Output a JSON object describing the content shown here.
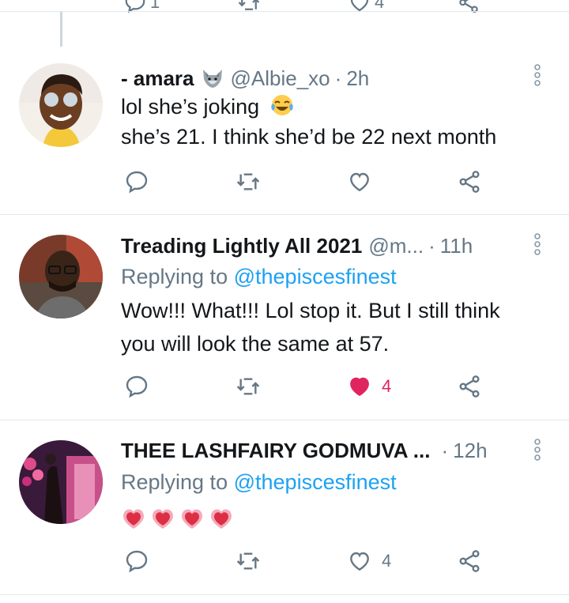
{
  "prev_tweet": {
    "reply_count": "1",
    "like_count": "4"
  },
  "tweets": [
    {
      "name": "- amara",
      "name_emoji": "wolf-emoji",
      "handle": "@Albie_xo",
      "dot": "·",
      "time": "2h",
      "lines": [
        "lol she’s joking",
        "she’s 21. I think she’d be 22 next month"
      ],
      "line_emoji": "tears-of-joy-emoji",
      "like_count": "",
      "liked": false
    },
    {
      "name": "Treading Lightly All 2021",
      "handle": "@m...",
      "dot": "·",
      "time": "11h",
      "replying_prefix": "Replying to",
      "replying_handle": "@thepiscesfinest",
      "lines": [
        "Wow!!! What!!! Lol stop it. But I still think",
        "you will look the same at 57."
      ],
      "like_count": "4",
      "liked": true
    },
    {
      "name": "THEE LASHFAIRY GODMUVA ...",
      "dot": "·",
      "time": "12h",
      "replying_prefix": "Replying to",
      "replying_handle": "@thepiscesfinest",
      "hearts": [
        "growing-heart-emoji",
        "growing-heart-emoji",
        "growing-heart-emoji",
        "growing-heart-emoji"
      ],
      "like_count": "4",
      "liked": false
    }
  ],
  "colors": {
    "link": "#1da1f2",
    "secondary": "#657786",
    "like_active": "#e0245e",
    "divider": "#e1e8ed"
  }
}
